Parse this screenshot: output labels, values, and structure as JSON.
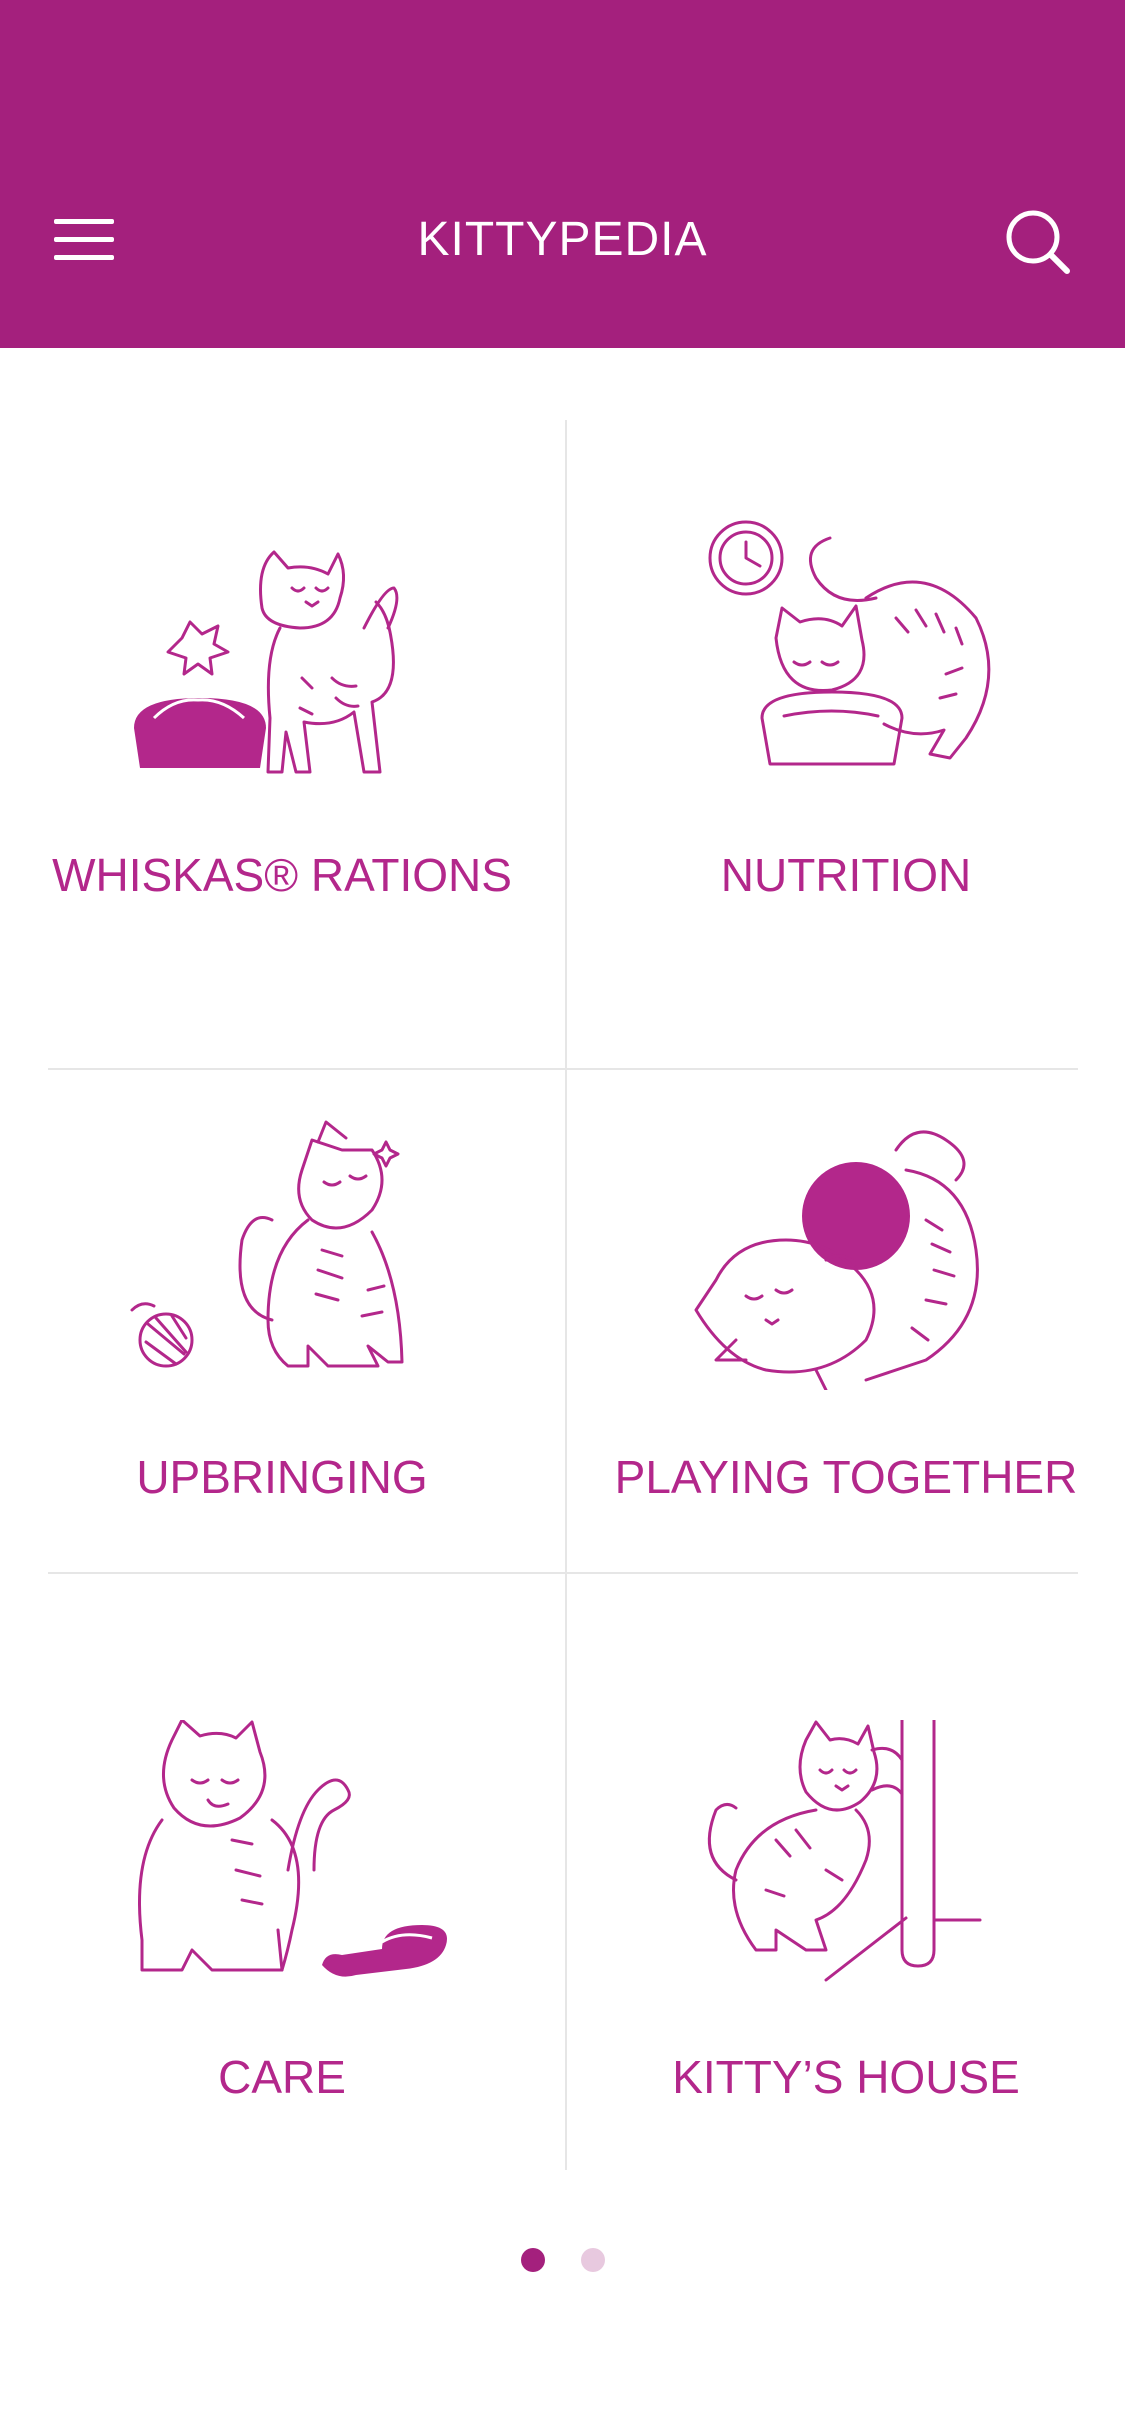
{
  "header": {
    "title": "KITTYPEDIA",
    "menu_icon": "hamburger-menu-icon",
    "search_icon": "search-icon",
    "background": "#a4207d"
  },
  "tiles": [
    {
      "label": "WHISKAS® RATIONS",
      "icon": "cat-with-food-bowl-icon"
    },
    {
      "label": "NUTRITION",
      "icon": "cat-eating-with-clock-icon"
    },
    {
      "label": "UPBRINGING",
      "icon": "cat-with-ball-of-yarn-icon"
    },
    {
      "label": "PLAYING TOGETHER",
      "icon": "cat-playing-with-ball-icon"
    },
    {
      "label": "CARE",
      "icon": "cat-grooming-with-brush-icon"
    },
    {
      "label": "KITTY’S HOUSE",
      "icon": "cat-scratching-post-icon"
    }
  ],
  "pagination": {
    "current_page": 1,
    "total_pages": 2,
    "active_color": "#a4207d",
    "inactive_color": "#e8c9df"
  },
  "accent_color": "#b3278b"
}
